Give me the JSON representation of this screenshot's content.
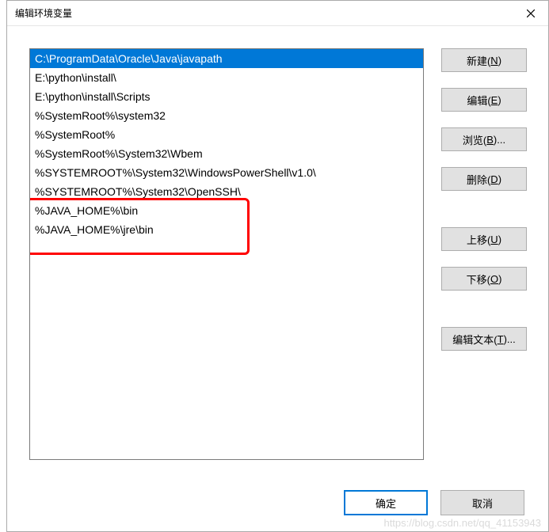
{
  "dialog": {
    "title": "编辑环境变量"
  },
  "list": {
    "items": [
      {
        "text": "C:\\ProgramData\\Oracle\\Java\\javapath",
        "selected": true
      },
      {
        "text": "E:\\python\\install\\",
        "selected": false
      },
      {
        "text": "E:\\python\\install\\Scripts",
        "selected": false
      },
      {
        "text": "%SystemRoot%\\system32",
        "selected": false
      },
      {
        "text": "%SystemRoot%",
        "selected": false
      },
      {
        "text": "%SystemRoot%\\System32\\Wbem",
        "selected": false
      },
      {
        "text": "%SYSTEMROOT%\\System32\\WindowsPowerShell\\v1.0\\",
        "selected": false
      },
      {
        "text": "%SYSTEMROOT%\\System32\\OpenSSH\\",
        "selected": false
      },
      {
        "text": "%JAVA_HOME%\\bin",
        "selected": false
      },
      {
        "text": "%JAVA_HOME%\\jre\\bin",
        "selected": false
      }
    ]
  },
  "buttons": {
    "new": {
      "pre": "新建(",
      "key": "N",
      "post": ")"
    },
    "edit": {
      "pre": "编辑(",
      "key": "E",
      "post": ")"
    },
    "browse": {
      "pre": "浏览(",
      "key": "B",
      "post": ")..."
    },
    "delete": {
      "pre": "删除(",
      "key": "D",
      "post": ")"
    },
    "moveup": {
      "pre": "上移(",
      "key": "U",
      "post": ")"
    },
    "movedown": {
      "pre": "下移(",
      "key": "O",
      "post": ")"
    },
    "edittext": {
      "pre": "编辑文本(",
      "key": "T",
      "post": ")..."
    },
    "ok": "确定",
    "cancel": "取消"
  },
  "watermark": "https://blog.csdn.net/qq_41153943"
}
